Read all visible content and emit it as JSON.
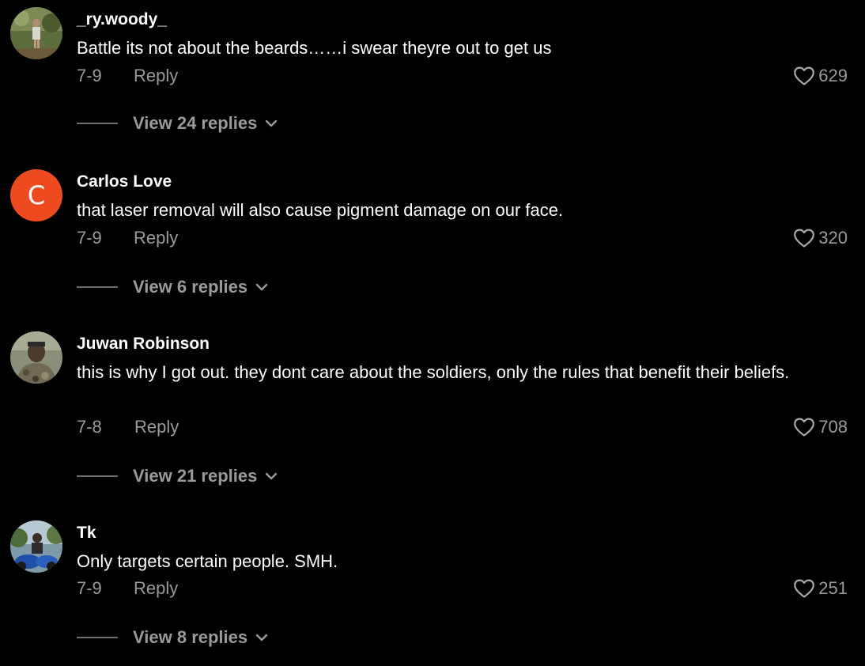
{
  "comments": [
    {
      "username": "_ry.woody_",
      "text": "Battle its not about the beards……i swear theyre out to get us",
      "date": "7-9",
      "reply_label": "Reply",
      "likes": "629",
      "view_replies": "View 24 replies"
    },
    {
      "username": "Carlos Love",
      "avatar_letter": "C",
      "text": "that laser removal will also cause pigment damage on our face.",
      "date": "7-9",
      "reply_label": "Reply",
      "likes": "320",
      "view_replies": "View 6 replies"
    },
    {
      "username": "Juwan Robinson",
      "text": "this is why I got out. they dont care about the soldiers, only the rules that benefit their beliefs.",
      "date": "7-8",
      "reply_label": "Reply",
      "likes": "708",
      "view_replies": "View 21 replies"
    },
    {
      "username": "Tk",
      "text": "Only targets certain people. SMH.",
      "date": "7-9",
      "reply_label": "Reply",
      "likes": "251",
      "view_replies": "View 8 replies"
    }
  ],
  "colors": {
    "background": "#000000",
    "primary_text": "#ffffff",
    "secondary_text": "#9a9a9a",
    "avatar_orange": "#ee4a1f"
  },
  "icons": [
    "heart-icon",
    "chevron-down-icon"
  ]
}
